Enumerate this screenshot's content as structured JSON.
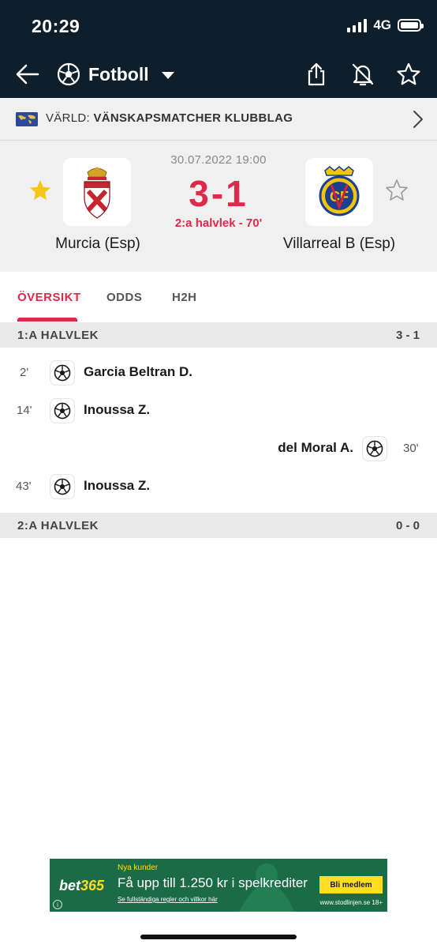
{
  "status_bar": {
    "time": "20:29",
    "network": "4G"
  },
  "nav": {
    "sport_label": "Fotboll",
    "icons": [
      "back-arrow-icon",
      "soccer-ball-icon",
      "share-icon",
      "bell-off-icon",
      "star-outline-icon"
    ]
  },
  "league": {
    "country": "VÄRLD:",
    "name": "VÄNSKAPSMATCHER KLUBBLAG"
  },
  "match": {
    "date": "30.07.2022 19:00",
    "score": "3-1",
    "status": "2:a halvlek - 70'",
    "home_team": "Murcia (Esp)",
    "away_team": "Villarreal B (Esp)",
    "home_favorite": true,
    "away_favorite": false
  },
  "tabs": [
    {
      "label": "ÖVERSIKT",
      "active": true
    },
    {
      "label": "ODDS",
      "active": false
    },
    {
      "label": "H2H",
      "active": false
    }
  ],
  "periods": [
    {
      "label": "1:A HALVLEK",
      "score": "3 - 1",
      "events": [
        {
          "minute": "2'",
          "player": "Garcia Beltran D.",
          "side": "home",
          "type": "goal"
        },
        {
          "minute": "14'",
          "player": "Inoussa Z.",
          "side": "home",
          "type": "goal"
        },
        {
          "minute": "30'",
          "player": "del Moral A.",
          "side": "away",
          "type": "goal"
        },
        {
          "minute": "43'",
          "player": "Inoussa Z.",
          "side": "home",
          "type": "goal"
        }
      ]
    },
    {
      "label": "2:A HALVLEK",
      "score": "0 - 0",
      "events": []
    }
  ],
  "ad": {
    "brand": "bet",
    "brand_num": "365",
    "kicker": "Nya kunder",
    "headline": "Få upp till 1.250 kr i spelkrediter",
    "terms": "Se fullständiga regler och villkor här",
    "cta": "Bli medlem",
    "footer": "www.stodlinjen.se 18+",
    "info": "i",
    "colors": {
      "background": "#1b6b46",
      "accent": "#ffdf1b"
    }
  },
  "colors": {
    "header_bg": "#0e1f2b",
    "accent_red": "#dd2a48",
    "favorite_gold": "#f5c518"
  }
}
